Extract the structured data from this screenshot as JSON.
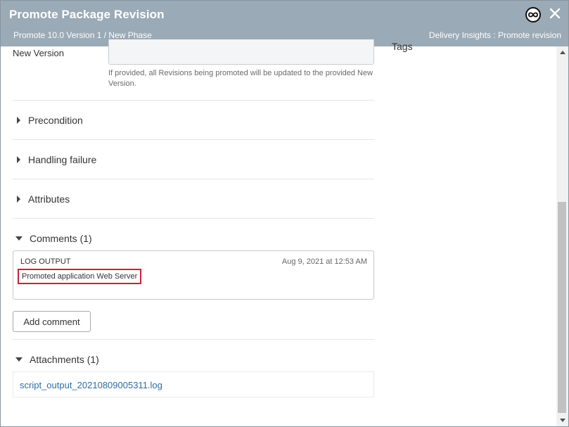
{
  "dialog": {
    "title": "Promote Package Revision",
    "breadcrumb": "Promote 10.0 Version 1 / New Phase",
    "context": "Delivery Insights : Promote revision",
    "close_icon": "close-icon",
    "logo_icon": "infinity-logo-icon"
  },
  "form": {
    "tags_label": "Tags",
    "new_version": {
      "label": "New Version",
      "value": "",
      "help": "If provided, all Revisions being promoted will be updated to the provided New Version."
    }
  },
  "sections": {
    "precondition": "Precondition",
    "handling_failure": "Handling failure",
    "attributes": "Attributes",
    "comments": "Comments (1)",
    "attachments": "Attachments (1)"
  },
  "comments": [
    {
      "type": "LOG OUTPUT",
      "timestamp": "Aug 9, 2021 at 12:53 AM",
      "text": "Promoted application Web Server"
    }
  ],
  "buttons": {
    "add_comment": "Add comment"
  },
  "attachments": [
    {
      "name": "script_output_20210809005311.log"
    }
  ],
  "colors": {
    "header_bg": "#9aaab6",
    "highlight_border": "#d0203a",
    "link": "#2f6da3"
  }
}
